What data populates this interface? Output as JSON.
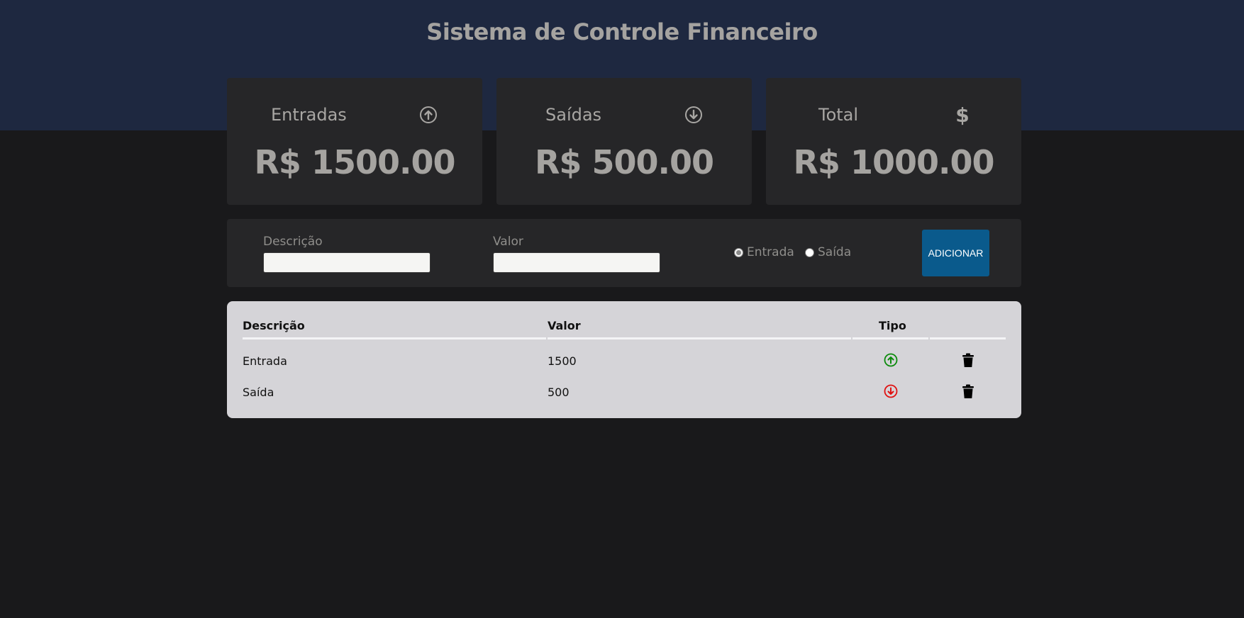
{
  "header": {
    "title": "Sistema de Controle Financeiro"
  },
  "summary": {
    "entradas": {
      "label": "Entradas",
      "value": "R$ 1500.00",
      "icon": "arrow-up-circle-icon"
    },
    "saidas": {
      "label": "Saídas",
      "value": "R$ 500.00",
      "icon": "arrow-down-circle-icon"
    },
    "total": {
      "label": "Total",
      "value": "R$ 1000.00",
      "icon_glyph": "$"
    }
  },
  "form": {
    "descricao_label": "Descrição",
    "descricao_value": "",
    "valor_label": "Valor",
    "valor_value": "",
    "radio_entrada_label": "Entrada",
    "radio_saida_label": "Saída",
    "selected_type": "Entrada",
    "add_button_label": "ADICIONAR"
  },
  "table": {
    "headers": [
      "Descrição",
      "Valor",
      "Tipo",
      ""
    ],
    "rows": [
      {
        "descricao": "Entrada",
        "valor": "1500",
        "tipo": "entrada"
      },
      {
        "descricao": "Saída",
        "valor": "500",
        "tipo": "saida"
      }
    ]
  },
  "colors": {
    "header_bg": "#1e2840",
    "page_bg": "#19191b",
    "card_bg": "#262628",
    "button_bg": "#0a5a8c",
    "entrada_icon": "#0a8a0a",
    "saida_icon": "#e01010",
    "table_bg": "#d5d4d8"
  }
}
